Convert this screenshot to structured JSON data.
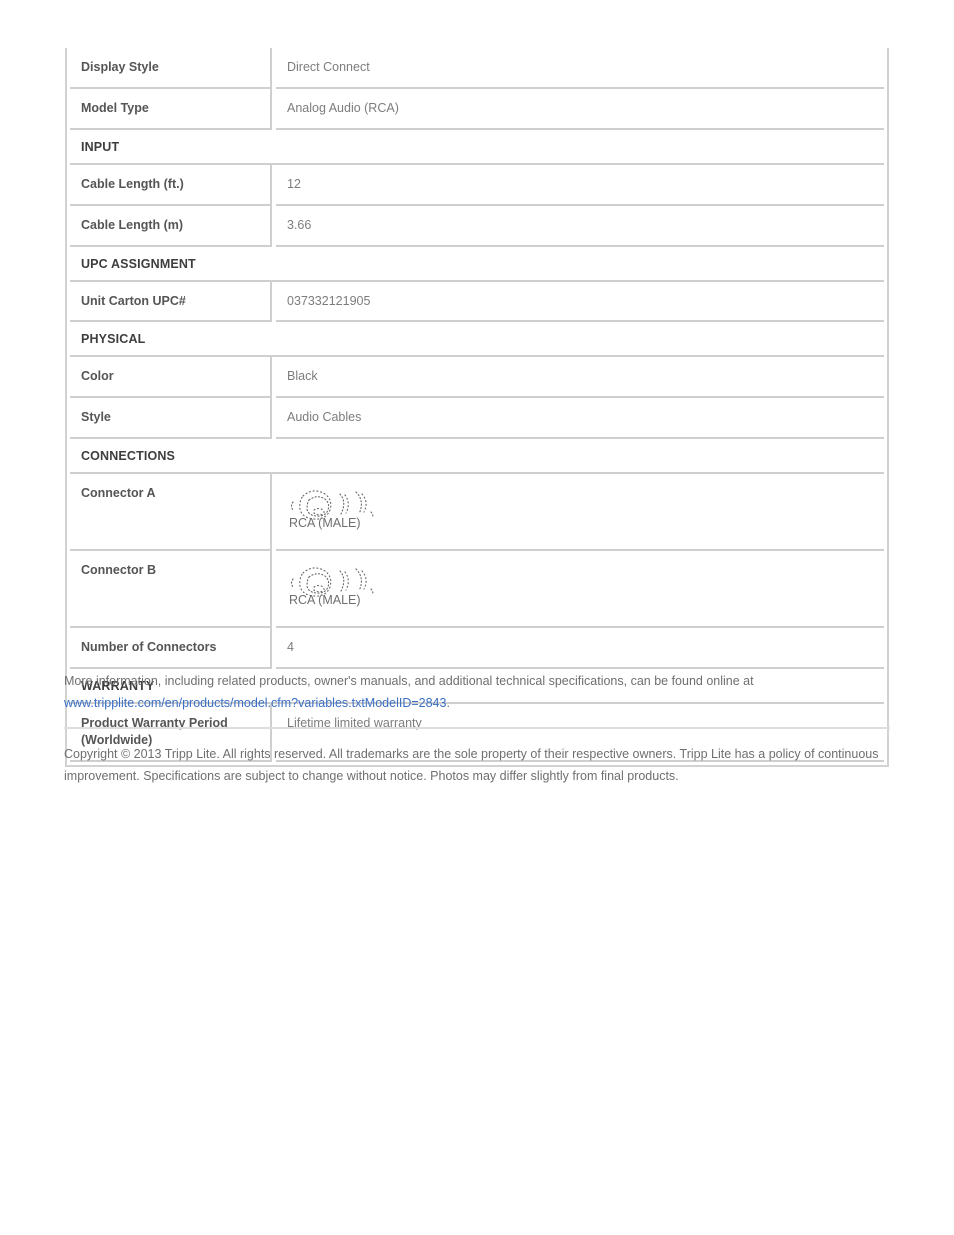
{
  "spec_table": {
    "rows": [
      {
        "kind": "row",
        "label": "Display Style",
        "value": "Direct Connect"
      },
      {
        "kind": "row",
        "label": "Model Type",
        "value": "Analog Audio (RCA)"
      },
      {
        "kind": "section",
        "label": "INPUT"
      },
      {
        "kind": "row",
        "label": "Cable Length (ft.)",
        "value": "12"
      },
      {
        "kind": "row",
        "label": "Cable Length (m)",
        "value": "3.66"
      },
      {
        "kind": "section",
        "label": "UPC ASSIGNMENT"
      },
      {
        "kind": "row",
        "label": "Unit Carton UPC#",
        "value": "037332121905"
      },
      {
        "kind": "section",
        "label": "PHYSICAL"
      },
      {
        "kind": "row",
        "label": "Color",
        "value": "Black"
      },
      {
        "kind": "row",
        "label": "Style",
        "value": "Audio Cables"
      },
      {
        "kind": "section",
        "label": "CONNECTIONS"
      },
      {
        "kind": "image_row",
        "label": "Connector A",
        "value": "RCA (MALE)",
        "icon": "rca-connector-image"
      },
      {
        "kind": "image_row",
        "label": "Connector B",
        "value": "RCA (MALE)",
        "icon": "rca-connector-image"
      },
      {
        "kind": "row",
        "label": "Number of Connectors",
        "value": "4"
      },
      {
        "kind": "section",
        "label": "WARRANTY"
      },
      {
        "kind": "row",
        "label": "Product Warranty Period (Worldwide)",
        "value": "Lifetime limited warranty"
      }
    ]
  },
  "footer": {
    "more_info_text": "More information, including related products, owner's manuals, and additional technical specifications, can be found online at",
    "link_text": "www.tripplite.com/en/products/model.cfm?variables.txtModelID=2843",
    "link_trailing_period": ".",
    "copyright_text": "Copyright © 2013 Tripp Lite. All rights reserved. All trademarks are the sole property of their respective owners. Tripp Lite has a policy of continuous improvement. Specifications are subject to change without notice. Photos may differ slightly from final products.",
    "link_color": "#3a6fc4"
  }
}
